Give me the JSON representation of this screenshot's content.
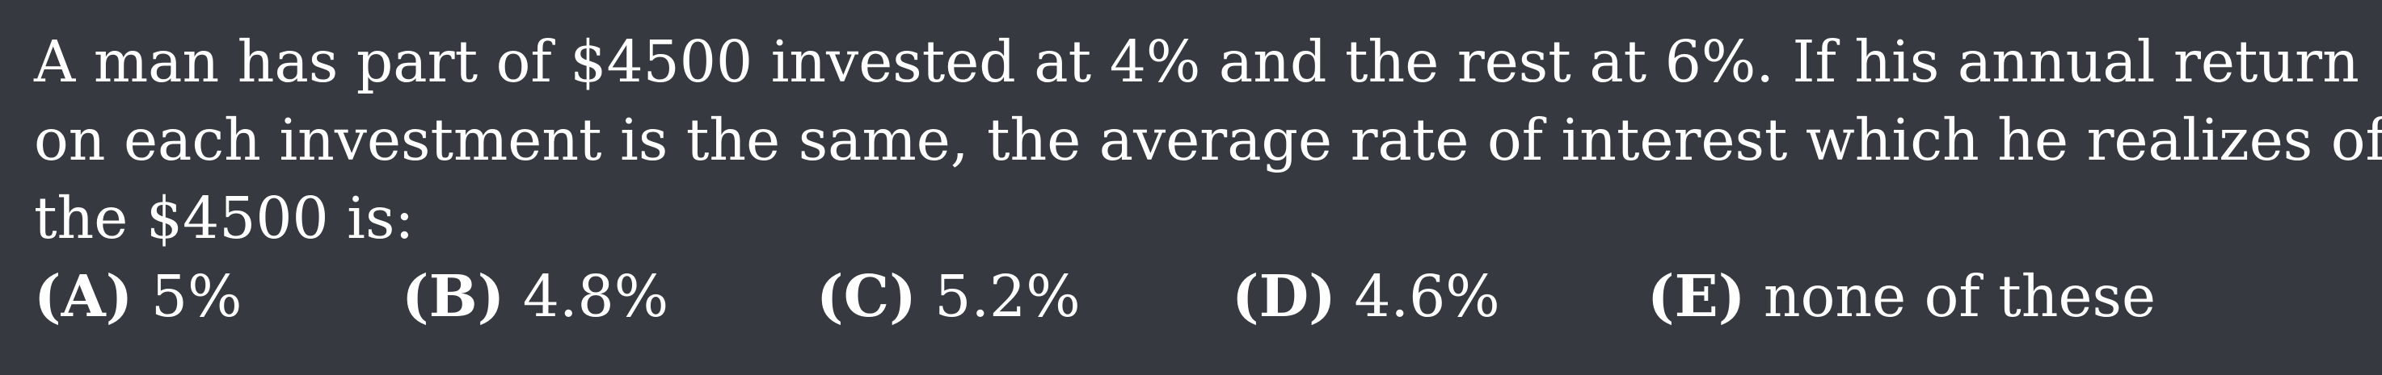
{
  "problem": {
    "stem_lines": [
      "A man has part of $4500 invested at 4% and the rest at 6%. If his annual return",
      "on each investment is the same, the average rate of interest which he realizes of",
      "the $4500 is:"
    ],
    "choices": [
      {
        "letter": "(A)",
        "text": "5%"
      },
      {
        "letter": "(B)",
        "text": "4.8%"
      },
      {
        "letter": "(C)",
        "text": "5.2%"
      },
      {
        "letter": "(D)",
        "text": "4.6%"
      },
      {
        "letter": "(E)",
        "text": "none of these"
      }
    ]
  }
}
